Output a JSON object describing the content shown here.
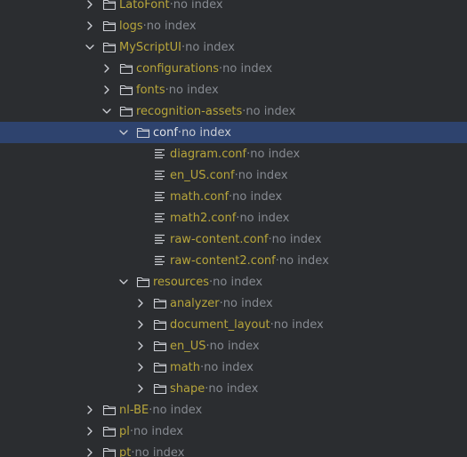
{
  "colors": {
    "background": "#2b2d30",
    "selected_row": "#2e436e",
    "unindexed_name": "#b7a53b",
    "selected_name": "#dfe1e5",
    "hint_text": "#868a91",
    "icon": "#ced0d6"
  },
  "tree": {
    "separator": " · ",
    "items": [
      {
        "name": "LatoFont",
        "meta": "no index",
        "type": "folder",
        "state": "collapsed",
        "depth": 0
      },
      {
        "name": "logs",
        "meta": "no index",
        "type": "folder",
        "state": "collapsed",
        "depth": 0
      },
      {
        "name": "MyScriptUI",
        "meta": "no index",
        "type": "folder",
        "state": "expanded",
        "depth": 0
      },
      {
        "name": "configurations",
        "meta": "no index",
        "type": "folder",
        "state": "collapsed",
        "depth": 1
      },
      {
        "name": "fonts",
        "meta": "no index",
        "type": "folder",
        "state": "collapsed",
        "depth": 1
      },
      {
        "name": "recognition-assets",
        "meta": "no index",
        "type": "folder",
        "state": "expanded",
        "depth": 1
      },
      {
        "name": "conf",
        "meta": "no index",
        "type": "folder",
        "state": "expanded",
        "depth": 2,
        "selected": true
      },
      {
        "name": "diagram.conf",
        "meta": "no index",
        "type": "file",
        "state": "none",
        "depth": 3
      },
      {
        "name": "en_US.conf",
        "meta": "no index",
        "type": "file",
        "state": "none",
        "depth": 3
      },
      {
        "name": "math.conf",
        "meta": "no index",
        "type": "file",
        "state": "none",
        "depth": 3
      },
      {
        "name": "math2.conf",
        "meta": "no index",
        "type": "file",
        "state": "none",
        "depth": 3
      },
      {
        "name": "raw-content.conf",
        "meta": "no index",
        "type": "file",
        "state": "none",
        "depth": 3
      },
      {
        "name": "raw-content2.conf",
        "meta": "no index",
        "type": "file",
        "state": "none",
        "depth": 3
      },
      {
        "name": "resources",
        "meta": "no index",
        "type": "folder",
        "state": "expanded",
        "depth": 2
      },
      {
        "name": "analyzer",
        "meta": "no index",
        "type": "folder",
        "state": "collapsed",
        "depth": 3
      },
      {
        "name": "document_layout",
        "meta": "no index",
        "type": "folder",
        "state": "collapsed",
        "depth": 3
      },
      {
        "name": "en_US",
        "meta": "no index",
        "type": "folder",
        "state": "collapsed",
        "depth": 3
      },
      {
        "name": "math",
        "meta": "no index",
        "type": "folder",
        "state": "collapsed",
        "depth": 3
      },
      {
        "name": "shape",
        "meta": "no index",
        "type": "folder",
        "state": "collapsed",
        "depth": 3
      },
      {
        "name": "nl-BE",
        "meta": "no index",
        "type": "folder",
        "state": "collapsed",
        "depth": 0
      },
      {
        "name": "pl",
        "meta": "no index",
        "type": "folder",
        "state": "collapsed",
        "depth": 0
      },
      {
        "name": "pt",
        "meta": "no index",
        "type": "folder",
        "state": "collapsed",
        "depth": 0
      }
    ]
  }
}
